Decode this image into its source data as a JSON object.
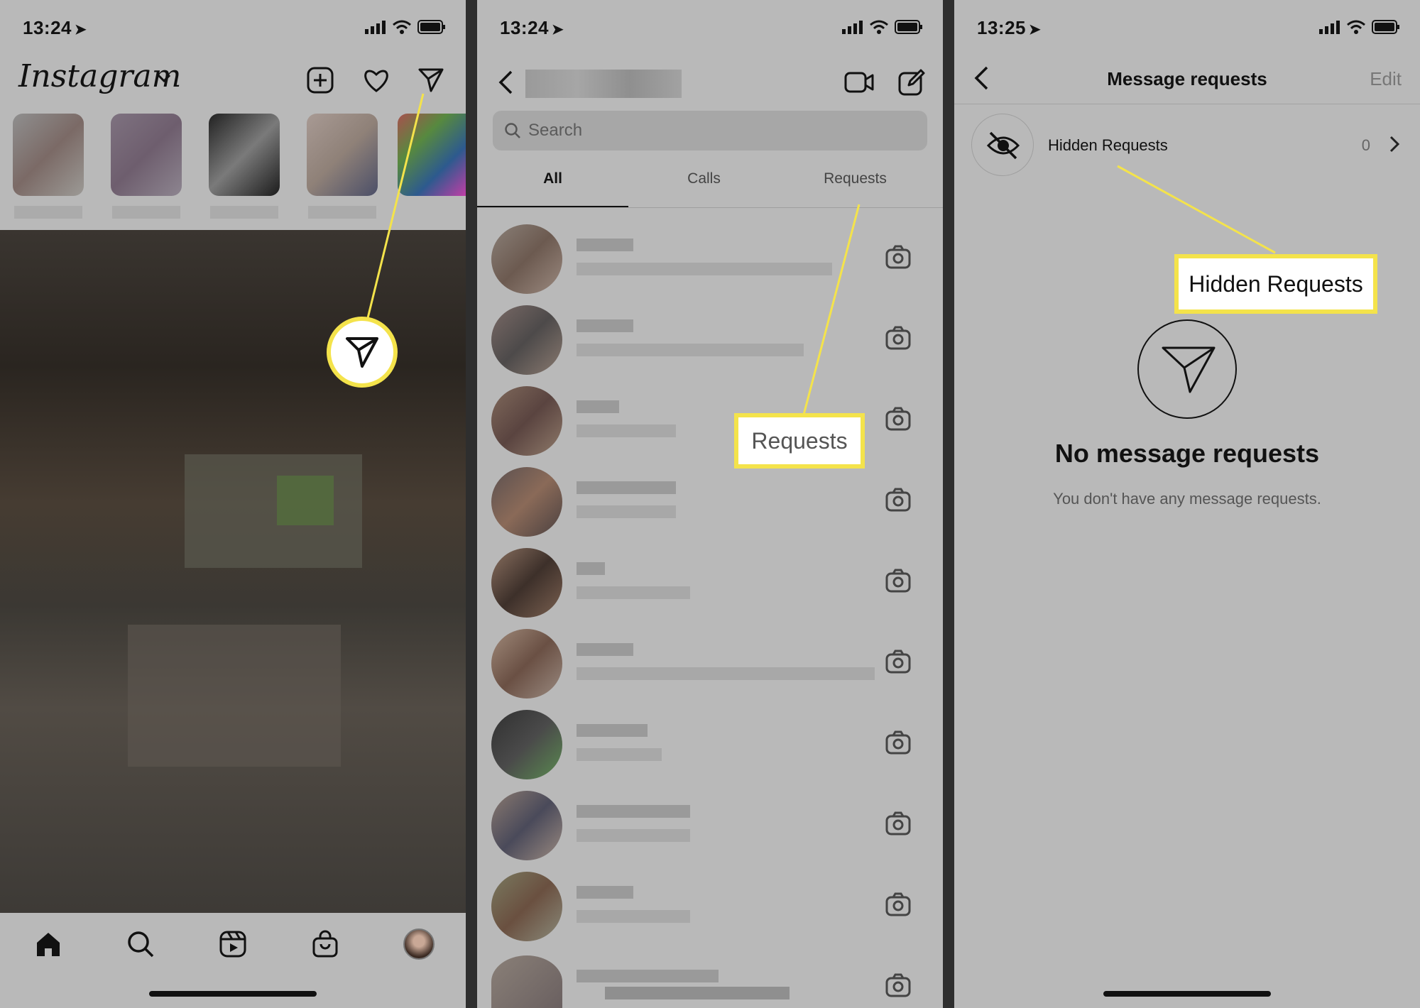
{
  "panel1": {
    "status_time": "13:24",
    "logo": "Instagram",
    "icons": {
      "dropdown": "chevron-down-icon",
      "new_post": "plus-square-icon",
      "activity": "heart-icon",
      "direct": "paper-plane-icon"
    },
    "nav": [
      "home-icon",
      "search-icon",
      "reels-icon",
      "shop-icon",
      "profile-avatar"
    ]
  },
  "panel2": {
    "status_time": "13:24",
    "search": {
      "placeholder": "Search"
    },
    "tabs": [
      {
        "label": "All"
      },
      {
        "label": "Calls"
      },
      {
        "label": "Requests"
      }
    ],
    "callout": "Requests"
  },
  "panel3": {
    "status_time": "13:25",
    "header": {
      "title": "Message requests",
      "edit": "Edit"
    },
    "hidden_row": {
      "label": "Hidden Requests",
      "count": "0"
    },
    "callout": "Hidden Requests",
    "empty": {
      "title": "No message requests",
      "subtitle": "You don't have any message requests."
    }
  },
  "colors": {
    "accent_yellow": "#f4e34b",
    "panel_bg": "#b9b9b9",
    "divider": "#2e2e2e"
  }
}
